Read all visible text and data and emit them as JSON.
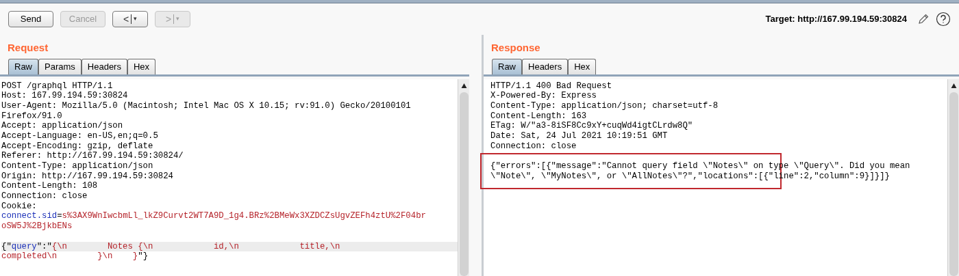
{
  "toolbar": {
    "buttons": [
      {
        "label": "Send",
        "disabled": false
      },
      {
        "label": "Cancel",
        "disabled": true
      }
    ],
    "nav_buttons": [
      {
        "label": "<",
        "caret": "▾",
        "disabled": false
      },
      {
        "label": ">",
        "caret": "▾",
        "disabled": true
      }
    ],
    "target": "Target: http://167.99.194.59:30824"
  },
  "request": {
    "title": "Request",
    "tabs": [
      {
        "label": "Raw",
        "selected": true
      },
      {
        "label": "Params",
        "selected": false
      },
      {
        "label": "Headers",
        "selected": false
      },
      {
        "label": "Hex",
        "selected": false
      }
    ],
    "lines": [
      {
        "highlighted": false,
        "segments": [
          {
            "kind": "plain",
            "text": "POST /graphql HTTP/1.1"
          }
        ]
      },
      {
        "highlighted": false,
        "segments": [
          {
            "kind": "plain",
            "text": "Host: 167.99.194.59:30824"
          }
        ]
      },
      {
        "highlighted": false,
        "segments": [
          {
            "kind": "plain",
            "text": "User-Agent: Mozilla/5.0 (Macintosh; Intel Mac OS X 10.15; rv:91.0) Gecko/20100101"
          }
        ]
      },
      {
        "highlighted": false,
        "segments": [
          {
            "kind": "plain",
            "text": "Firefox/91.0"
          }
        ]
      },
      {
        "highlighted": false,
        "segments": [
          {
            "kind": "plain",
            "text": "Accept: application/json"
          }
        ]
      },
      {
        "highlighted": false,
        "segments": [
          {
            "kind": "plain",
            "text": "Accept-Language: en-US,en;q=0.5"
          }
        ]
      },
      {
        "highlighted": false,
        "segments": [
          {
            "kind": "plain",
            "text": "Accept-Encoding: gzip, deflate"
          }
        ]
      },
      {
        "highlighted": false,
        "segments": [
          {
            "kind": "plain",
            "text": "Referer: http://167.99.194.59:30824/"
          }
        ]
      },
      {
        "highlighted": false,
        "segments": [
          {
            "kind": "plain",
            "text": "Content-Type: application/json"
          }
        ]
      },
      {
        "highlighted": false,
        "segments": [
          {
            "kind": "plain",
            "text": "Origin: http://167.99.194.59:30824"
          }
        ]
      },
      {
        "highlighted": false,
        "segments": [
          {
            "kind": "plain",
            "text": "Content-Length: 108"
          }
        ]
      },
      {
        "highlighted": false,
        "segments": [
          {
            "kind": "plain",
            "text": "Connection: close"
          }
        ]
      },
      {
        "highlighted": false,
        "segments": [
          {
            "kind": "plain",
            "text": "Cookie:"
          }
        ]
      },
      {
        "highlighted": false,
        "segments": [
          {
            "kind": "key",
            "text": "connect.sid"
          },
          {
            "kind": "plain",
            "text": "="
          },
          {
            "kind": "value",
            "text": "s%3AX9WnIwcbmLl_lkZ9Curvt2WT7A9D_1g4.BRz%2BMeWx3XZDCZsUgvZEFh4ztU%2F04br"
          }
        ]
      },
      {
        "highlighted": false,
        "segments": [
          {
            "kind": "value",
            "text": "oSW5J%2BjkbENs"
          }
        ]
      },
      {
        "highlighted": false
      },
      {
        "highlighted": true,
        "segments": [
          {
            "kind": "plain",
            "text": "{\""
          },
          {
            "kind": "key",
            "text": "query"
          },
          {
            "kind": "plain",
            "text": "\":\""
          },
          {
            "kind": "value",
            "text": "{\\n        Notes {\\n            id,\\n            title,\\n"
          }
        ]
      },
      {
        "highlighted": false,
        "segments": [
          {
            "kind": "value",
            "text": "completed\\n        }\\n    }"
          },
          {
            "kind": "plain",
            "text": "\"}"
          }
        ]
      }
    ]
  },
  "response": {
    "title": "Response",
    "tabs": [
      {
        "label": "Raw",
        "selected": true
      },
      {
        "label": "Headers",
        "selected": false
      },
      {
        "label": "Hex",
        "selected": false
      }
    ],
    "headers": [
      "HTTP/1.1 400 Bad Request",
      "X-Powered-By: Express",
      "Content-Type: application/json; charset=utf-8",
      "Content-Length: 163",
      "ETag: W/\"a3-8iSF8Cc9xY+cuqWd4igtCLrdw8Q\"",
      "Date: Sat, 24 Jul 2021 10:19:51 GMT",
      "Connection: close"
    ],
    "error_box": {
      "lines": [
        "{\"errors\":[{\"message\":\"Cannot query field \\\"Notes\\\" on type \\\"Query\\\". Did you mean",
        "\\\"Note\\\", \\\"MyNotes\\\", or \\\"AllNotes\\\"?\",\"locations\":[{\"line\":2,\"column\":9}]}]}"
      ]
    }
  }
}
